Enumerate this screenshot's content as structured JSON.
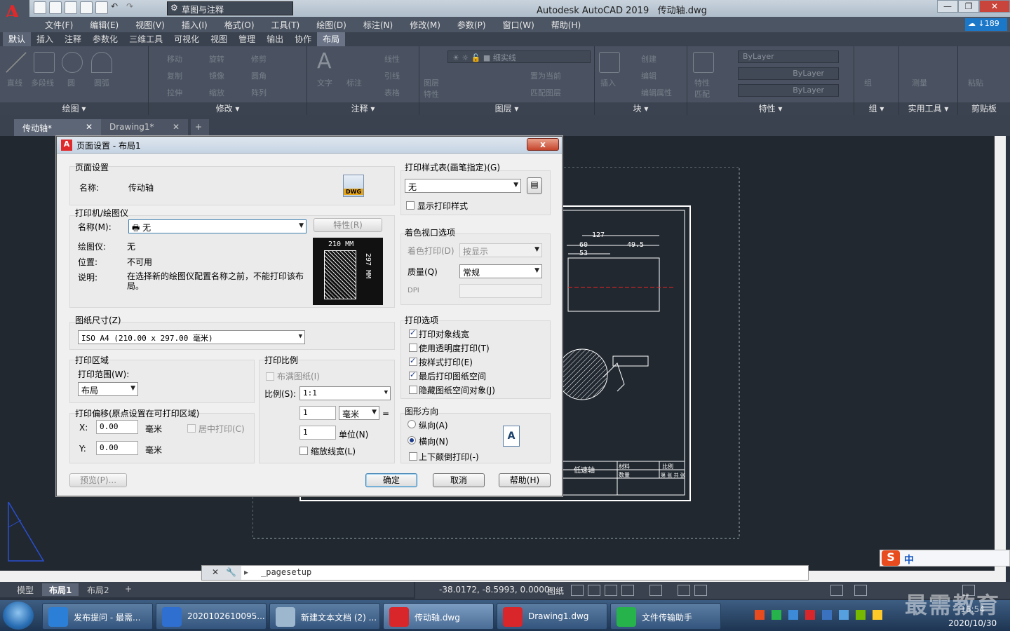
{
  "app": {
    "title": "Autodesk AutoCAD 2019",
    "filename": "传动轴.dwg",
    "workspace": "草图与注释",
    "logo": "A",
    "cloud_count": "189"
  },
  "menus": [
    "文件(F)",
    "编辑(E)",
    "视图(V)",
    "插入(I)",
    "格式(O)",
    "工具(T)",
    "绘图(D)",
    "标注(N)",
    "修改(M)",
    "参数(P)",
    "窗口(W)",
    "帮助(H)"
  ],
  "ribbon_tabs": [
    "默认",
    "插入",
    "注释",
    "参数化",
    "三维工具",
    "可视化",
    "视图",
    "管理",
    "输出",
    "协作",
    "布局"
  ],
  "ribbon_panels": [
    "绘图",
    "修改",
    "注释",
    "图层",
    "块",
    "特性",
    "组",
    "实用工具",
    "剪贴板"
  ],
  "ribbon": {
    "draw_tools": [
      "直线",
      "多段线",
      "圆",
      "圆弧"
    ],
    "modify_tools": [
      "移动",
      "旋转",
      "修剪",
      "复制",
      "镜像",
      "圆角",
      "拉伸",
      "缩放",
      "阵列"
    ],
    "annot_tools": [
      "文字",
      "标注",
      "线性",
      "引线",
      "表格"
    ],
    "layer_name": "细实线",
    "layer_tools": [
      "图层特性",
      "置为当前",
      "匹配图层"
    ],
    "block_tools": [
      "插入",
      "创建",
      "编辑",
      "编辑属性"
    ],
    "prop_tools": [
      "特性匹配"
    ],
    "bylayer": [
      "ByLayer",
      "ByLayer",
      "ByLayer"
    ],
    "group_tools": [
      "组"
    ],
    "util_tools": [
      "测量"
    ],
    "clip_tools": [
      "粘贴"
    ]
  },
  "doc_tabs": [
    "传动轴*",
    "Drawing1*"
  ],
  "layout_tabs": [
    "模型",
    "布局1",
    "布局2"
  ],
  "command": "_pagesetup",
  "status": {
    "coords": "-38.0172, -8.5993, 0.0000",
    "paper": "图纸"
  },
  "dialog": {
    "title": "页面设置 - 布局1",
    "close": "x",
    "page_setup": {
      "group": "页面设置",
      "name_label": "名称:",
      "name_value": "传动轴",
      "dwg": "DWG"
    },
    "printer": {
      "group": "打印机/绘图仪",
      "name_label": "名称(M):",
      "name_value": "无",
      "properties_btn": "特性(R)",
      "plotter_label": "绘图仪:",
      "plotter_value": "无",
      "where_label": "位置:",
      "where_value": "不可用",
      "desc_label": "说明:",
      "desc_value": "在选择新的绘图仪配置名称之前，不能打印该布局。",
      "preview_w": "210  MM",
      "preview_h": "297  MM"
    },
    "paper_size": {
      "group": "图纸尺寸(Z)",
      "value": "ISO A4 (210.00 x 297.00 毫米)"
    },
    "plot_area": {
      "group": "打印区域",
      "range_label": "打印范围(W):",
      "range_value": "布局"
    },
    "plot_offset": {
      "group": "打印偏移(原点设置在可打印区域)",
      "x_label": "X:",
      "x_value": "0.00",
      "y_label": "Y:",
      "y_value": "0.00",
      "unit": "毫米",
      "center": "居中打印(C)"
    },
    "plot_scale": {
      "group": "打印比例",
      "fit": "布满图纸(I)",
      "scale_label": "比例(S):",
      "scale_value": "1:1",
      "v1": "1",
      "unit": "毫米",
      "eq": "=",
      "v2": "1",
      "unit2": "单位(N)",
      "lw": "缩放线宽(L)"
    },
    "style_table": {
      "group": "打印样式表(画笔指定)(G)",
      "value": "无",
      "show": "显示打印样式"
    },
    "shaded": {
      "group": "着色视口选项",
      "shade_label": "着色打印(D)",
      "shade_value": "按显示",
      "quality_label": "质量(Q)",
      "quality_value": "常规",
      "dpi_label": "DPI"
    },
    "plot_options": {
      "group": "打印选项",
      "items": [
        {
          "label": "打印对象线宽",
          "checked": true
        },
        {
          "label": "使用透明度打印(T)",
          "checked": false
        },
        {
          "label": "按样式打印(E)",
          "checked": true
        },
        {
          "label": "最后打印图纸空间",
          "checked": true
        },
        {
          "label": "隐藏图纸空间对象(J)",
          "checked": false
        }
      ]
    },
    "orientation": {
      "group": "图形方向",
      "portrait": "纵向(A)",
      "landscape": "横向(N)",
      "upside": "上下颠倒打印(-)",
      "icon": "A"
    },
    "buttons": {
      "preview": "预览(P)...",
      "ok": "确定",
      "cancel": "取消",
      "help": "帮助(H)"
    }
  },
  "cad": {
    "dims": [
      "127",
      "60",
      "49.5",
      "53"
    ],
    "title_block": "低速轴",
    "table": [
      "材料",
      "数量",
      "比例",
      "第 张 共 张"
    ]
  },
  "ime": {
    "text": "中"
  },
  "taskbar": {
    "items": [
      "发布提问 - 最需...",
      "2020102610095...",
      "新建文本文档 (2) ...",
      "传动轴.dwg",
      "Drawing1.dwg",
      "文件传输助手"
    ],
    "time": "16:54",
    "date": "2020/10/30",
    "watermark": "最需教育"
  }
}
